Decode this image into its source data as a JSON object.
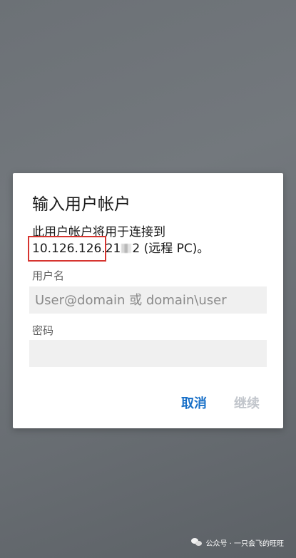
{
  "dialog": {
    "title": "输入用户帐户",
    "message_line1": "此用户帐户将用于连接到",
    "ip_visible_start": "10.126.126.21",
    "ip_visible_end": "2",
    "message_suffix": " (远程 PC)。",
    "username_label": "用户名",
    "username_placeholder": "User@domain 或 domain\\user",
    "username_value": "",
    "password_label": "密码",
    "password_value": "",
    "cancel_label": "取消",
    "continue_label": "继续"
  },
  "watermark": {
    "text": "公众号 · 一只会飞的旺旺",
    "icon": "wechat-icon"
  },
  "colors": {
    "accent": "#1870c8",
    "disabled": "#c2c6cc",
    "highlight": "#d6342f",
    "input_background": "#f0f0f0",
    "dialog_background": "#ffffff"
  }
}
